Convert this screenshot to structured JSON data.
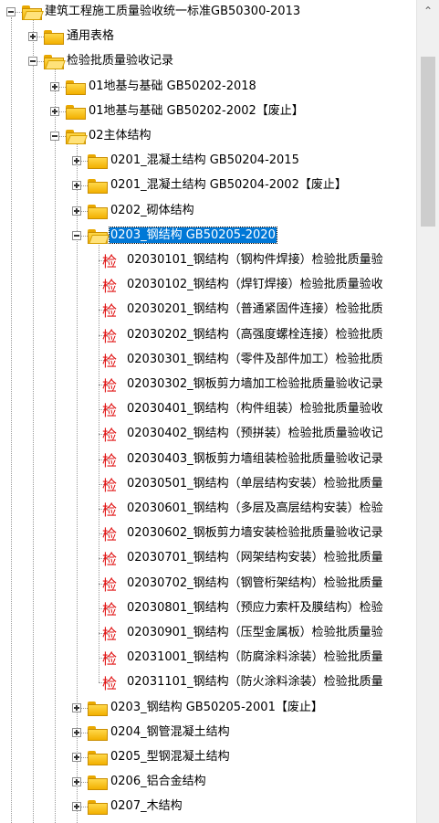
{
  "tree": {
    "nodes": [
      {
        "label": "建筑工程施工质量验收统一标准GB50300-2013",
        "level": 0,
        "type": "folder",
        "state": "open"
      },
      {
        "label": "通用表格",
        "level": 1,
        "type": "folder",
        "state": "closed"
      },
      {
        "label": "检验批质量验收记录",
        "level": 1,
        "type": "folder",
        "state": "open"
      },
      {
        "label": "01地基与基础 GB50202-2018",
        "level": 2,
        "type": "folder",
        "state": "closed"
      },
      {
        "label": "01地基与基础 GB50202-2002【废止】",
        "level": 2,
        "type": "folder",
        "state": "closed"
      },
      {
        "label": "02主体结构",
        "level": 2,
        "type": "folder",
        "state": "open"
      },
      {
        "label": "0201_混凝土结构 GB50204-2015",
        "level": 3,
        "type": "folder",
        "state": "closed"
      },
      {
        "label": "0201_混凝土结构 GB50204-2002【废止】",
        "level": 3,
        "type": "folder",
        "state": "closed"
      },
      {
        "label": "0202_砌体结构",
        "level": 3,
        "type": "folder",
        "state": "closed"
      },
      {
        "label": "0203_钢结构 GB50205-2020",
        "level": 3,
        "type": "folder",
        "state": "open",
        "selected": true
      },
      {
        "label": "02030101_钢结构（钢构件焊接）检验批质量验",
        "level": 4,
        "type": "doc"
      },
      {
        "label": "02030102_钢结构（焊钉焊接）检验批质量验收",
        "level": 4,
        "type": "doc"
      },
      {
        "label": "02030201_钢结构（普通紧固件连接）检验批质",
        "level": 4,
        "type": "doc"
      },
      {
        "label": "02030202_钢结构（高强度螺栓连接）检验批质",
        "level": 4,
        "type": "doc"
      },
      {
        "label": "02030301_钢结构（零件及部件加工）检验批质",
        "level": 4,
        "type": "doc"
      },
      {
        "label": "02030302_钢板剪力墙加工检验批质量验收记录",
        "level": 4,
        "type": "doc"
      },
      {
        "label": "02030401_钢结构（构件组装）检验批质量验收",
        "level": 4,
        "type": "doc"
      },
      {
        "label": "02030402_钢结构（预拼装）检验批质量验收记",
        "level": 4,
        "type": "doc"
      },
      {
        "label": "02030403_钢板剪力墙组装检验批质量验收记录",
        "level": 4,
        "type": "doc"
      },
      {
        "label": "02030501_钢结构（单层结构安装）检验批质量",
        "level": 4,
        "type": "doc"
      },
      {
        "label": "02030601_钢结构（多层及高层结构安装）检验",
        "level": 4,
        "type": "doc"
      },
      {
        "label": "02030602_钢板剪力墙安装检验批质量验收记录",
        "level": 4,
        "type": "doc"
      },
      {
        "label": "02030701_钢结构（网架结构安装）检验批质量",
        "level": 4,
        "type": "doc"
      },
      {
        "label": "02030702_钢结构（钢管桁架结构）检验批质量",
        "level": 4,
        "type": "doc"
      },
      {
        "label": "02030801_钢结构（预应力索杆及膜结构）检验",
        "level": 4,
        "type": "doc"
      },
      {
        "label": "02030901_钢结构（压型金属板）检验批质量验",
        "level": 4,
        "type": "doc"
      },
      {
        "label": "02031001_钢结构（防腐涂料涂装）检验批质量",
        "level": 4,
        "type": "doc"
      },
      {
        "label": "02031101_钢结构（防火涂料涂装）检验批质量",
        "level": 4,
        "type": "doc"
      },
      {
        "label": "0203_钢结构 GB50205-2001【废止】",
        "level": 3,
        "type": "folder",
        "state": "closed"
      },
      {
        "label": "0204_钢管混凝土结构",
        "level": 3,
        "type": "folder",
        "state": "closed"
      },
      {
        "label": "0205_型钢混凝土结构",
        "level": 3,
        "type": "folder",
        "state": "closed"
      },
      {
        "label": "0206_铝合金结构",
        "level": 3,
        "type": "folder",
        "state": "closed"
      },
      {
        "label": "0207_木结构",
        "level": 3,
        "type": "folder",
        "state": "closed"
      }
    ],
    "doc_icon_char": "检",
    "doc_icon_color": "#e01010",
    "selection_color": "#0078d7"
  },
  "scrollbar": {
    "up_arrow_icon": "chevron-up-icon",
    "down_arrow_icon": "chevron-down-icon",
    "up_glyph": "⌃",
    "down_glyph": "⌄"
  }
}
